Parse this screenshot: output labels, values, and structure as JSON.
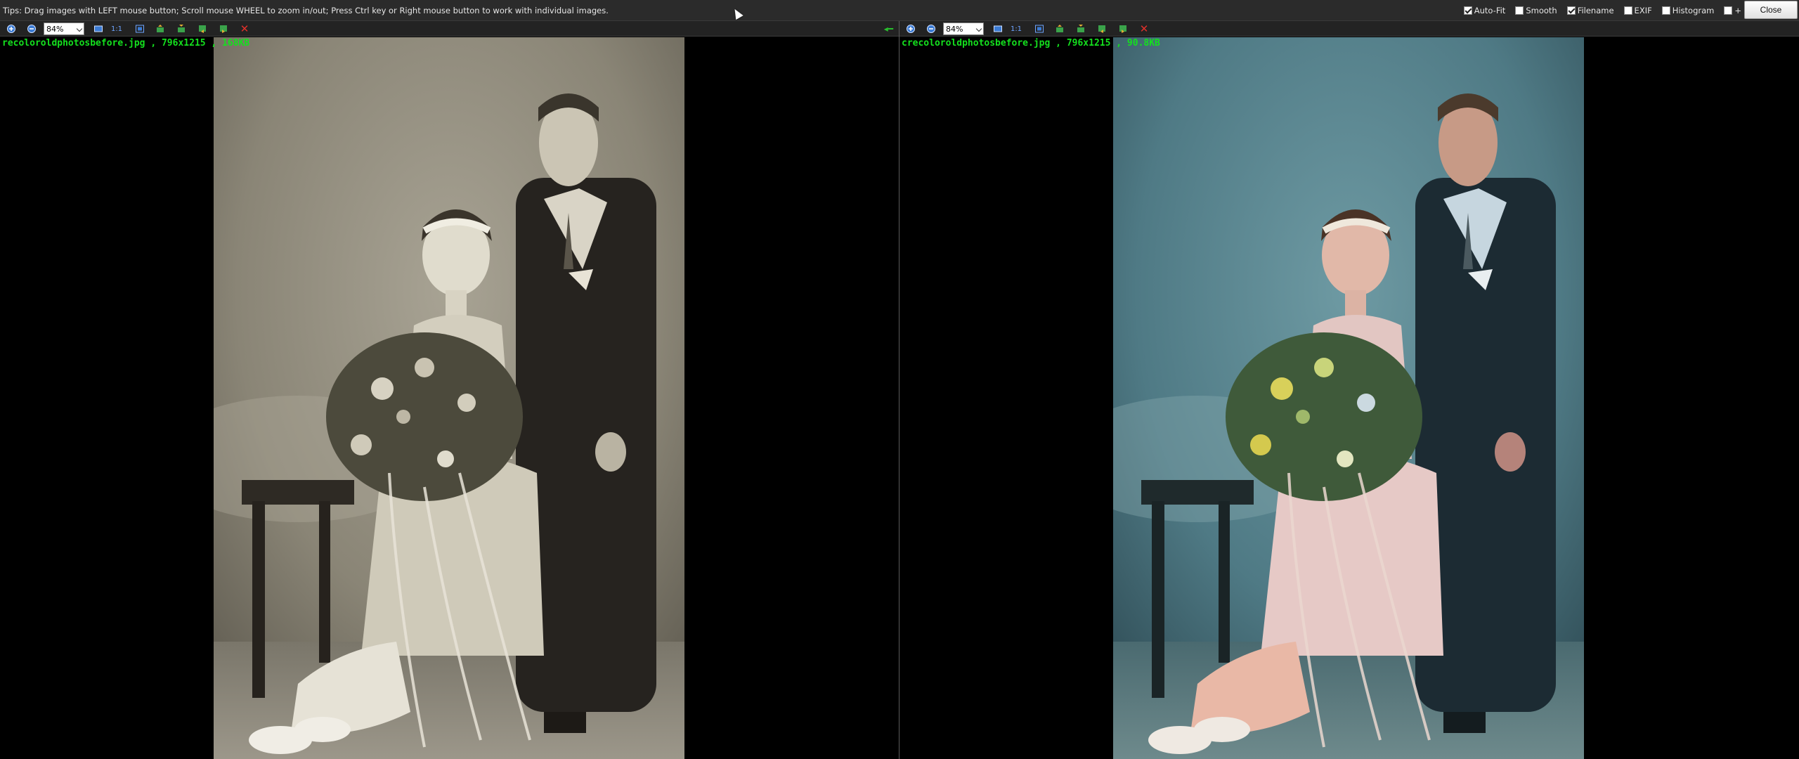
{
  "topbar": {
    "tips": "Tips: Drag images with LEFT mouse button; Scroll mouse WHEEL to zoom in/out; Press Ctrl key or Right mouse button to work with individual images.",
    "options": [
      {
        "label": "Auto-Fit",
        "checked": true
      },
      {
        "label": "Smooth",
        "checked": false
      },
      {
        "label": "Filename",
        "checked": true
      },
      {
        "label": "EXIF",
        "checked": false
      },
      {
        "label": "Histogram",
        "checked": false
      },
      {
        "label": "+",
        "checked": false
      }
    ],
    "close_label": "Close"
  },
  "left_pane": {
    "zoom": "84%",
    "filename": "recoloroldphotosbefore.jpg",
    "dimensions": "796x1215",
    "filesize": "168KB"
  },
  "right_pane": {
    "zoom": "84%",
    "filename": "crecoloroldphotosbefore.jpg",
    "dimensions": "796x1215",
    "filesize": "90.8KB"
  },
  "toolbar_icons": [
    "zoom-in-icon",
    "zoom-out-icon",
    "fit-icon",
    "actual-size-icon",
    "fit-window-icon",
    "rotate-left-icon",
    "rotate-right-icon",
    "prev-image-icon",
    "next-image-icon",
    "remove-icon"
  ],
  "toolbar": {
    "actual_size_label": "1:1"
  },
  "colors": {
    "filename_text": "#14e01e",
    "toolbar_bg": "#232323",
    "remove_icon": "#e0302a"
  }
}
